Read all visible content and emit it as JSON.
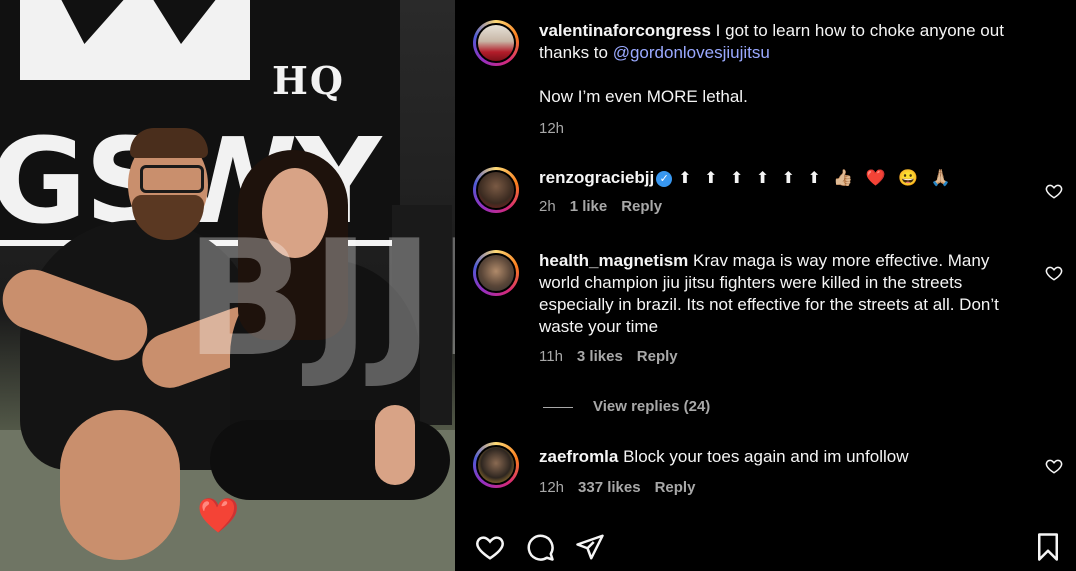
{
  "photo": {
    "banner_hq": "HQ",
    "banner_word": "GSWY",
    "watermark": "BJJDOC▷",
    "sticker_emoji": "❤️"
  },
  "caption": {
    "username": "valentinaforcongress",
    "text_before": " I got to learn how to choke anyone out thanks to ",
    "mention": "@gordonlovesjiujitsu",
    "line2": "Now I’m even MORE lethal.",
    "time": "12h"
  },
  "comments": [
    {
      "username": "renzograciebjj",
      "verified": true,
      "text": "⬆ ⬆ ⬆ ⬆ ⬆ ⬆ 👍🏼 ❤️ 😀 🙏🏼",
      "time": "2h",
      "likes": "1 like",
      "reply": "Reply"
    },
    {
      "username": "health_magnetism",
      "text": " Krav maga is way more effective. Many world champion jiu jitsu fighters were killed in the streets especially in brazil. Its not effective for the streets at all. Don’t waste your time",
      "time": "11h",
      "likes": "3 likes",
      "reply": "Reply"
    },
    {
      "username": "zaefromla",
      "text": " Block your toes again and im unfollow",
      "time": "12h",
      "likes": "337 likes",
      "reply": "Reply"
    }
  ],
  "view_replies": "View replies (24)",
  "icons": [
    "heart-icon",
    "comment-icon",
    "share-icon",
    "bookmark-icon",
    "verified-badge-icon"
  ],
  "colors": {
    "background": "#000000",
    "text": "#f5f5f5",
    "muted": "#a8a8a8",
    "mention": "#9aa9ff",
    "verified": "#3897f0"
  }
}
